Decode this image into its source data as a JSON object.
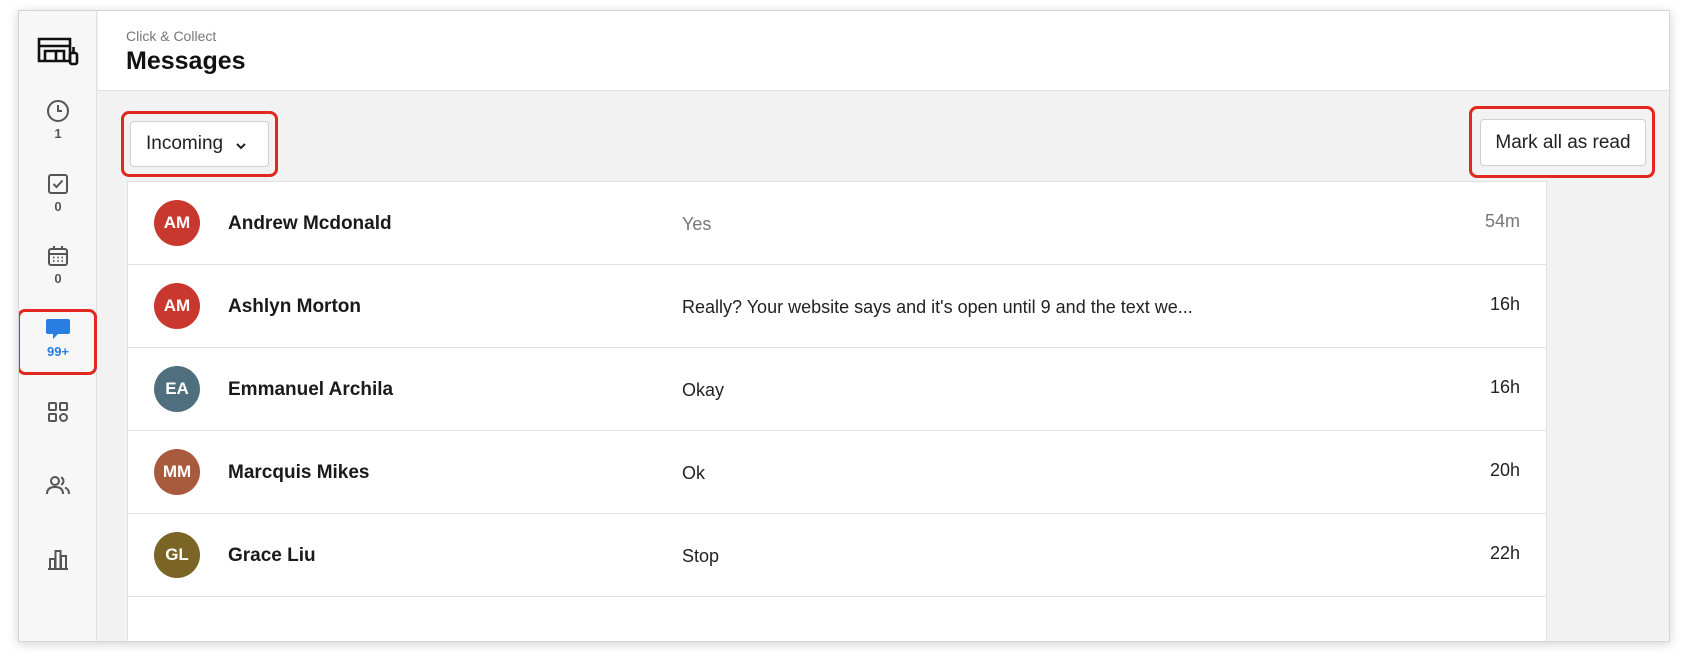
{
  "colors": {
    "accent_blue": "#2a7de1",
    "highlight_red": "#e0281e"
  },
  "sidebar": {
    "logo": "storefront-logo-icon",
    "items": [
      {
        "icon": "clock-icon",
        "count": "1"
      },
      {
        "icon": "checkbox-icon",
        "count": "0"
      },
      {
        "icon": "calendar-icon",
        "count": "0"
      },
      {
        "icon": "chat-bubble-icon",
        "count": "99+",
        "active": true
      },
      {
        "icon": "grid-apps-icon",
        "count": ""
      },
      {
        "icon": "people-icon",
        "count": ""
      },
      {
        "icon": "bar-chart-icon",
        "count": ""
      }
    ]
  },
  "header": {
    "breadcrumb": "Click & Collect",
    "title": "Messages"
  },
  "toolbar": {
    "filter_selected": "Incoming",
    "mark_all_label": "Mark all as read"
  },
  "messages": [
    {
      "initials": "AM",
      "avatar_color": "#c8382f",
      "name": "Andrew Mcdonald",
      "text": "Yes",
      "time": "54m",
      "read": true
    },
    {
      "initials": "AM",
      "avatar_color": "#c8382f",
      "name": "Ashlyn Morton",
      "text": "Really? Your website says and it's open until 9 and the text we...",
      "time": "16h",
      "read": false
    },
    {
      "initials": "EA",
      "avatar_color": "#4f6f7f",
      "name": "Emmanuel Archila",
      "text": "Okay",
      "time": "16h",
      "read": false
    },
    {
      "initials": "MM",
      "avatar_color": "#a85a3c",
      "name": "Marcquis Mikes",
      "text": "Ok",
      "time": "20h",
      "read": false
    },
    {
      "initials": "GL",
      "avatar_color": "#7a6426",
      "name": "Grace Liu",
      "text": "Stop",
      "time": "22h",
      "read": false
    }
  ]
}
